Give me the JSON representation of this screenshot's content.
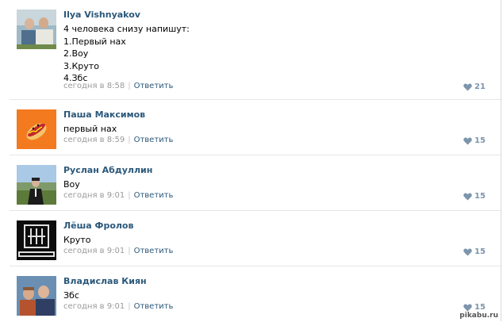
{
  "comments": [
    {
      "author": "Ilya Vishnyakov",
      "lines": [
        "4 человека снизу напишут:",
        "1.Первый нах",
        "2.Воу",
        "3.Круто",
        "4.Збс"
      ],
      "time": "сегодня в 8:58",
      "reply": "Ответить",
      "likes": "21",
      "avatar": "two-young-men-photo"
    },
    {
      "author": "Паша Максимов",
      "lines": [
        "первый нах"
      ],
      "time": "сегодня в 8:59",
      "reply": "Ответить",
      "likes": "15",
      "avatar": "hotdog-cartoon"
    },
    {
      "author": "Руслан Абдуллин",
      "lines": [
        "Воу"
      ],
      "time": "сегодня в 9:01",
      "reply": "Ответить",
      "likes": "15",
      "avatar": "man-in-suit-photo"
    },
    {
      "author": "Лёша Фролов",
      "lines": [
        "Круто"
      ],
      "time": "сегодня в 9:01",
      "reply": "Ответить",
      "likes": "15",
      "avatar": "rammstein-logo"
    },
    {
      "author": "Владислав Киян",
      "lines": [
        "Збс"
      ],
      "time": "сегодня в 9:01",
      "reply": "Ответить",
      "likes": "15",
      "avatar": "group-of-boys-photo"
    }
  ],
  "watermark": "pikabu.ru",
  "colors": {
    "link": "#2b587a",
    "meta": "#999999",
    "like": "#7c95ad"
  }
}
